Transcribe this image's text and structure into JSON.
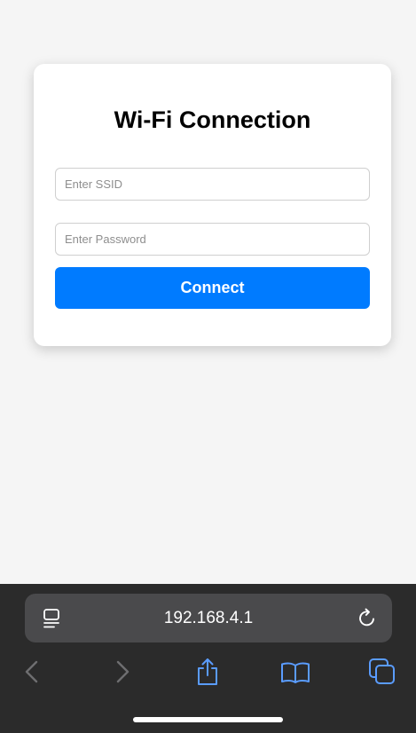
{
  "form": {
    "title": "Wi-Fi Connection",
    "ssid_placeholder": "Enter SSID",
    "ssid_value": "",
    "password_placeholder": "Enter Password",
    "password_value": "",
    "connect_label": "Connect"
  },
  "browser": {
    "address": "192.168.4.1",
    "icons": {
      "page_menu": "page-menu-icon",
      "reload": "reload-icon",
      "back": "chevron-left-icon",
      "forward": "chevron-right-icon",
      "share": "share-icon",
      "bookmarks": "book-icon",
      "tabs": "tabs-icon"
    }
  },
  "colors": {
    "accent": "#007bff",
    "page_background": "#f5f5f5",
    "toolbar_background": "#2b2b2b",
    "address_bar_background": "#4a4a4c",
    "toolbar_icon_active": "#5a9cff",
    "toolbar_icon_disabled": "#6e6e70"
  }
}
